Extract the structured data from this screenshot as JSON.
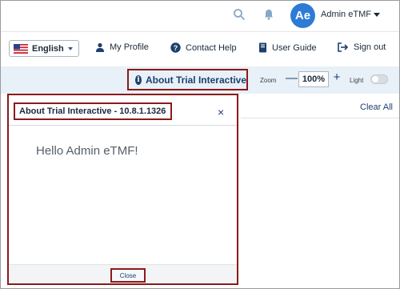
{
  "header": {
    "search_icon": "search-icon",
    "bell_icon": "bell-icon",
    "avatar_initials": "Ae",
    "user_name": "Admin eTMF"
  },
  "nav": {
    "language": "English",
    "my_profile": "My Profile",
    "contact_help": "Contact Help",
    "user_guide": "User Guide",
    "sign_out": "Sign out"
  },
  "toolbar": {
    "about_label": "About Trial Interactive",
    "zoom_label": "Zoom",
    "zoom_value": "100%",
    "zoom_minus": "—",
    "zoom_plus": "+",
    "light_label": "Light",
    "light_on": false
  },
  "content": {
    "clear_all": "Clear All"
  },
  "dialog": {
    "title": "About Trial Interactive - 10.8.1.1326",
    "close_x": "×",
    "message": "Hello Admin eTMF!",
    "close_button": "Close"
  },
  "colors": {
    "accent": "#1e3f6e",
    "avatar": "#2e7bd6",
    "highlight_border": "#8b1a1a",
    "toolbar_bg": "#e8f0f8"
  }
}
